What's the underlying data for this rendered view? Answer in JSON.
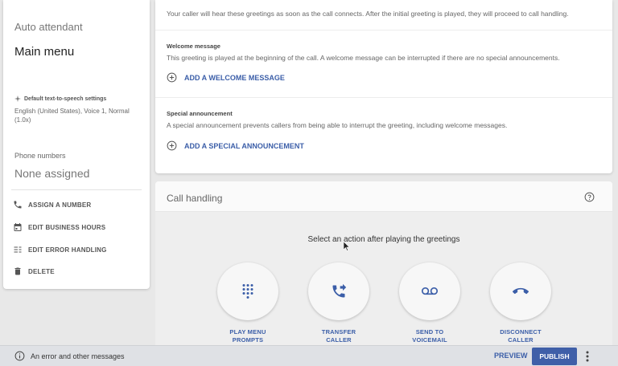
{
  "left_panel": {
    "category": "Auto attendant",
    "title": "Main menu",
    "tts_heading": "Default text-to-speech settings",
    "tts_value": "English (United States), Voice 1, Normal (1.0x)",
    "phone_label": "Phone numbers",
    "phone_value": "None assigned",
    "actions": [
      {
        "label": "ASSIGN A NUMBER",
        "icon": "phone-icon"
      },
      {
        "label": "EDIT BUSINESS HOURS",
        "icon": "calendar-icon"
      },
      {
        "label": "EDIT ERROR HANDLING",
        "icon": "list-edit-icon"
      },
      {
        "label": "DELETE",
        "icon": "trash-icon"
      }
    ]
  },
  "greetings": {
    "intro": "Your caller will hear these greetings as soon as the call connects. After the initial greeting is played, they will proceed to call handling.",
    "welcome": {
      "title": "Welcome message",
      "description": "This greeting is played at the beginning of the call. A welcome message can be interrupted if there are no special announcements.",
      "add_label": "ADD A WELCOME MESSAGE"
    },
    "special": {
      "title": "Special announcement",
      "description": "A special announcement prevents callers from being able to interrupt the greeting, including welcome messages.",
      "add_label": "ADD A SPECIAL ANNOUNCEMENT"
    }
  },
  "call_handling": {
    "title": "Call handling",
    "prompt": "Select an action after playing the greetings",
    "options": [
      {
        "line1": "PLAY MENU",
        "line2": "PROMPTS",
        "icon": "dialpad-icon"
      },
      {
        "line1": "TRANSFER",
        "line2": "CALLER",
        "icon": "phone-forward-icon"
      },
      {
        "line1": "SEND TO",
        "line2": "VOICEMAIL",
        "icon": "voicemail-icon"
      },
      {
        "line1": "DISCONNECT",
        "line2": "CALLER",
        "icon": "call-end-icon"
      }
    ]
  },
  "bottom_bar": {
    "message": "An error and other messages",
    "preview_label": "PREVIEW",
    "publish_label": "PUBLISH"
  },
  "colors": {
    "accent": "#3b5ea8",
    "publish_bg": "#3f5fa8"
  }
}
